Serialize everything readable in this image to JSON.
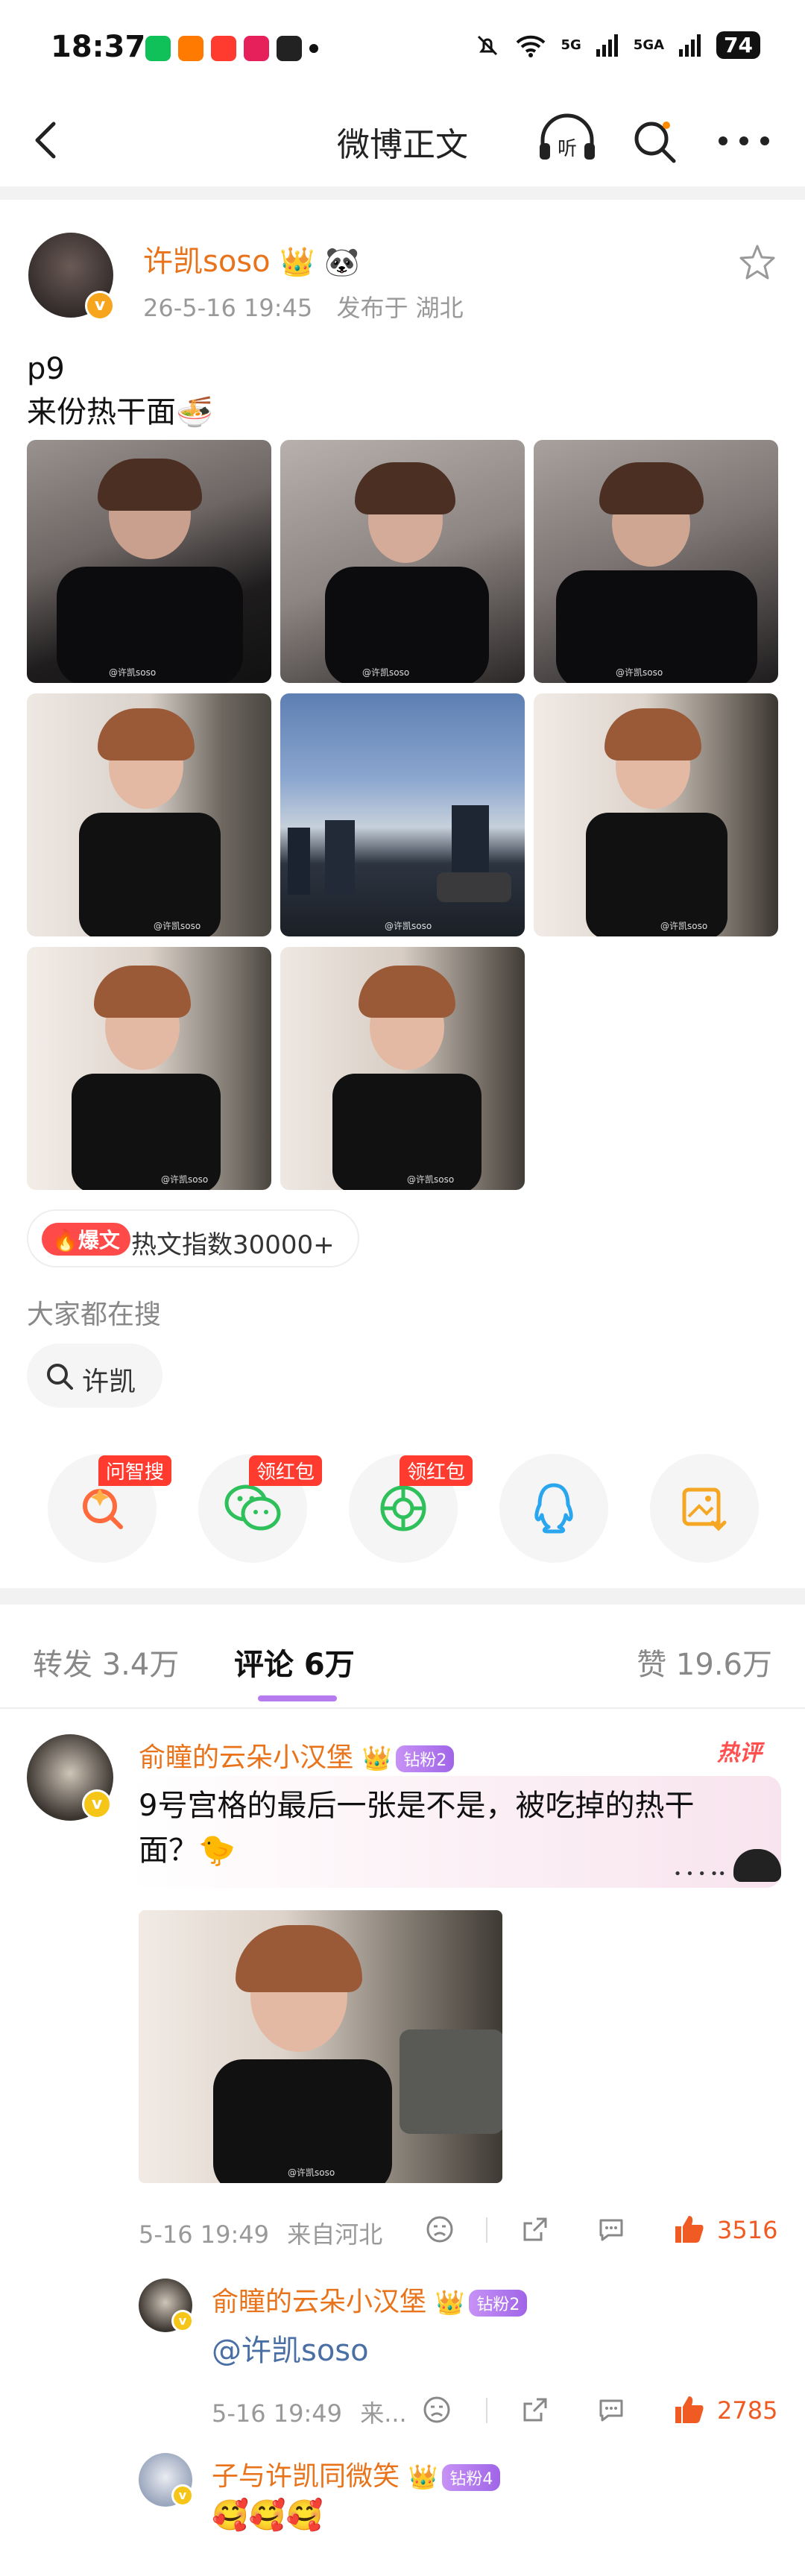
{
  "status_bar": {
    "time": "18:37",
    "app_icons": [
      "爱奇艺",
      "头条",
      "头条",
      "返利",
      "小红书"
    ],
    "signal1": "5G",
    "signal2": "5GA",
    "battery": "74"
  },
  "nav": {
    "title": "微博正文"
  },
  "post": {
    "author": "许凯soso",
    "time": "26-5-16 19:45",
    "location": "发布于 湖北",
    "text_line1": "p9",
    "text_line2": "来份热干面🍜",
    "watermark": "@许凯soso",
    "hot_badge": "爆文",
    "hot_index": "热文指数30000+",
    "search_heading": "大家都在搜",
    "search_chip": "许凯"
  },
  "share": {
    "tags": [
      "问智搜",
      "领红包",
      "领红包"
    ]
  },
  "tabs": {
    "repost": "转发 3.4万",
    "comments": "评论 6万",
    "likes": "赞 19.6万"
  },
  "comments": [
    {
      "user": "俞瞳的云朵小汉堡",
      "badge": "钻粉2",
      "hot_tag": "热评",
      "text": "9号宫格的最后一张是不是，被吃掉的热干面？🐤",
      "time": "5-16 19:49",
      "location": "来自河北",
      "likes": "3516"
    }
  ],
  "replies": [
    {
      "user": "俞瞳的云朵小汉堡",
      "badge": "钻粉2",
      "text": "@许凯soso",
      "time": "5-16 19:49",
      "location": "来...",
      "likes": "2785"
    },
    {
      "user": "子与许凯同微笑",
      "badge": "钻粉4",
      "text": "🥰🥰🥰"
    }
  ],
  "colors": {
    "accent_orange": "#e8731a",
    "like_orange": "#f05a23",
    "tab_underline": "#b57bee",
    "hot_red": "#ff3b2f"
  }
}
